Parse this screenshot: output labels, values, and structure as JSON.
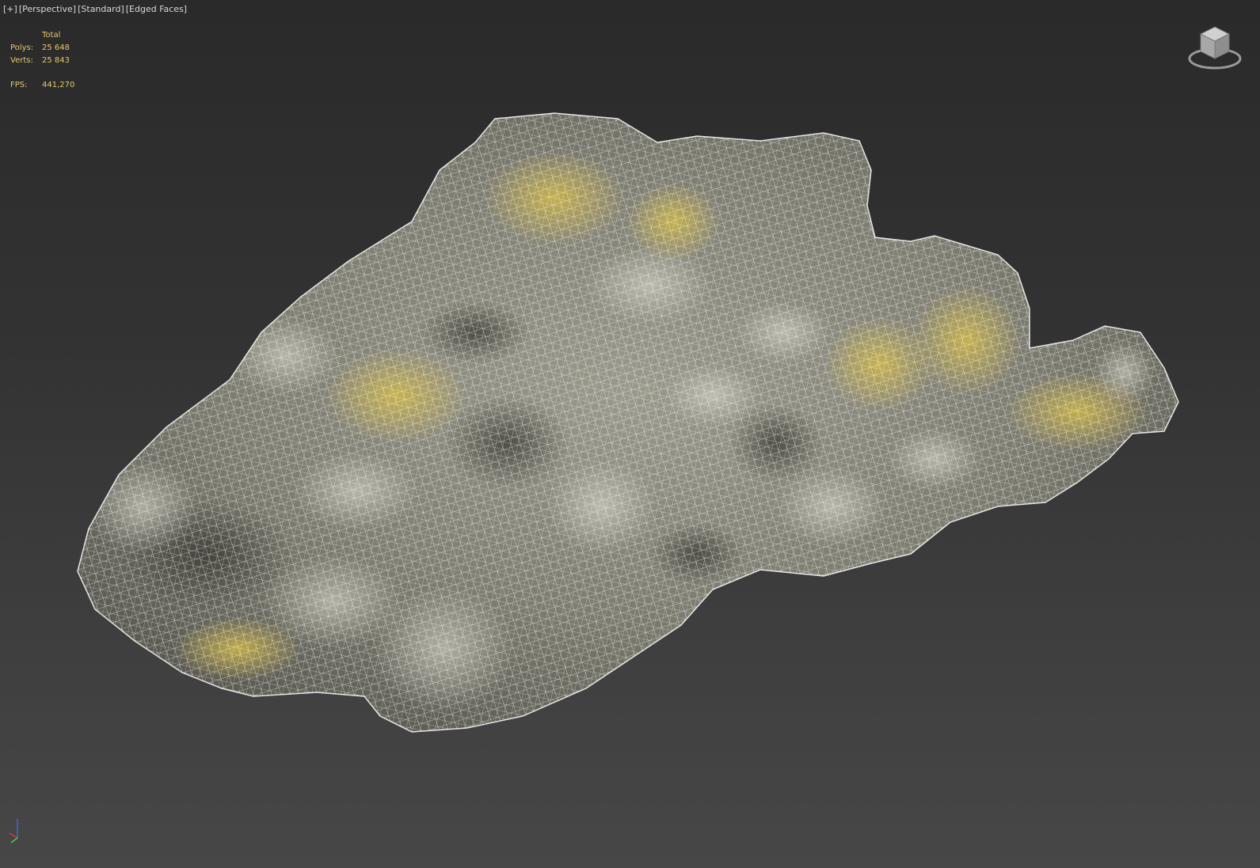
{
  "viewport": {
    "labels": [
      "[+]",
      "[Perspective]",
      "[Standard]",
      "[Edged Faces]"
    ]
  },
  "stats": {
    "header": "Total",
    "polys_label": "Polys:",
    "polys_value": "25 648",
    "verts_label": "Verts:",
    "verts_value": "25 843",
    "fps_label": "FPS:",
    "fps_value": "441,270"
  },
  "icons": {
    "viewcube": "viewcube-icon",
    "axis_gizmo": "axis-tripod-icon"
  },
  "colors": {
    "stats_text": "#e8c96a",
    "label_text": "#d8d8d8",
    "wire": "#ffffff",
    "rock_base": "#8d8d80",
    "moss": "#c8b040"
  }
}
